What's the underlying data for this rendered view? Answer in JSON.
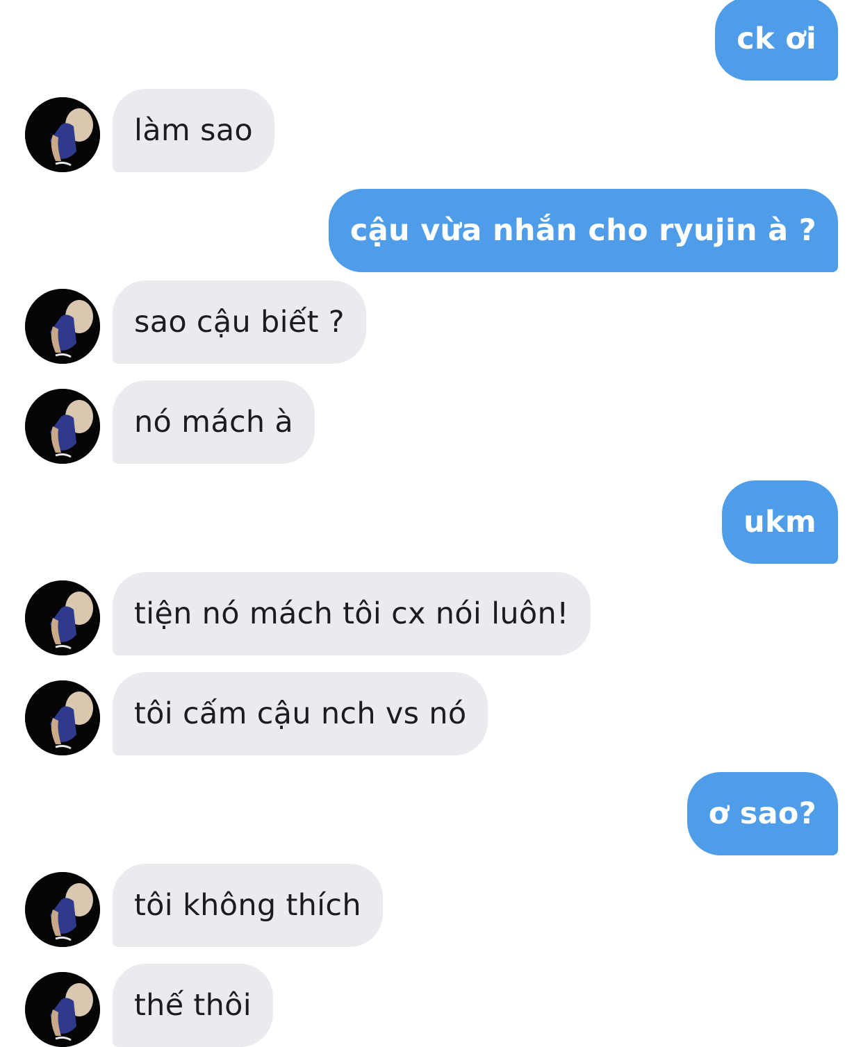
{
  "conversation": {
    "colors": {
      "outgoing_bubble": "#4f9de8",
      "incoming_bubble": "#e9ebef",
      "incoming_text": "#1c1c1e",
      "outgoing_text": "#ffffff"
    },
    "messages": [
      {
        "sender": "me",
        "text": "ck ơi"
      },
      {
        "sender": "them",
        "text": "làm sao"
      },
      {
        "sender": "me",
        "text": "cậu vừa nhắn cho ryujin à ?"
      },
      {
        "sender": "them",
        "text": "sao cậu biết ?"
      },
      {
        "sender": "them",
        "text": "nó mách à"
      },
      {
        "sender": "me",
        "text": "ukm"
      },
      {
        "sender": "them",
        "text": "tiện nó mách tôi cx nói luôn!"
      },
      {
        "sender": "them",
        "text": "tôi cấm cậu nch vs nó"
      },
      {
        "sender": "me",
        "text": "ơ sao?"
      },
      {
        "sender": "them",
        "text": "tôi không thích"
      },
      {
        "sender": "them",
        "text": "thế thôi"
      }
    ]
  }
}
